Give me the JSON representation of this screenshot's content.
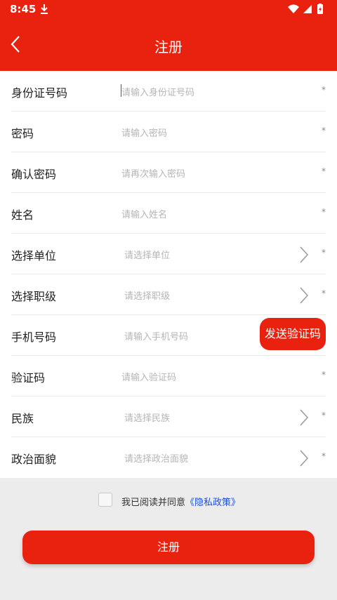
{
  "status_bar": {
    "time": "8:45"
  },
  "header": {
    "title": "注册"
  },
  "form": {
    "rows": [
      {
        "label": "身份证号码",
        "placeholder": "请输入身份证号码",
        "required": "*"
      },
      {
        "label": "密码",
        "placeholder": "请输入密码",
        "required": "*"
      },
      {
        "label": "确认密码",
        "placeholder": "请再次输入密码",
        "required": "*"
      },
      {
        "label": "姓名",
        "placeholder": "请输入姓名",
        "required": "*"
      },
      {
        "label": "选择单位",
        "placeholder": "请选择单位",
        "required": "*"
      },
      {
        "label": "选择职级",
        "placeholder": "请选择职级",
        "required": "*"
      },
      {
        "label": "手机号码",
        "placeholder": "请输入手机号码",
        "action": "发送验证码"
      },
      {
        "label": "验证码",
        "placeholder": "请输入验证码",
        "required": "*"
      },
      {
        "label": "民族",
        "placeholder": "请选择民族",
        "required": "*"
      },
      {
        "label": "政治面貌",
        "placeholder": "请选择政治面貌",
        "required": "*"
      }
    ]
  },
  "agreement": {
    "text": "我已阅读并同意",
    "link": "《隐私政策》"
  },
  "actions": {
    "register_label": "注册"
  },
  "colors": {
    "primary": "#e8220e",
    "link": "#1a4fd8",
    "background": "#ececec"
  },
  "icons": [
    "download-icon",
    "wifi-icon",
    "signal-icon",
    "battery-icon",
    "back-arrow-icon",
    "chevron-right-icon",
    "checkbox-icon"
  ]
}
